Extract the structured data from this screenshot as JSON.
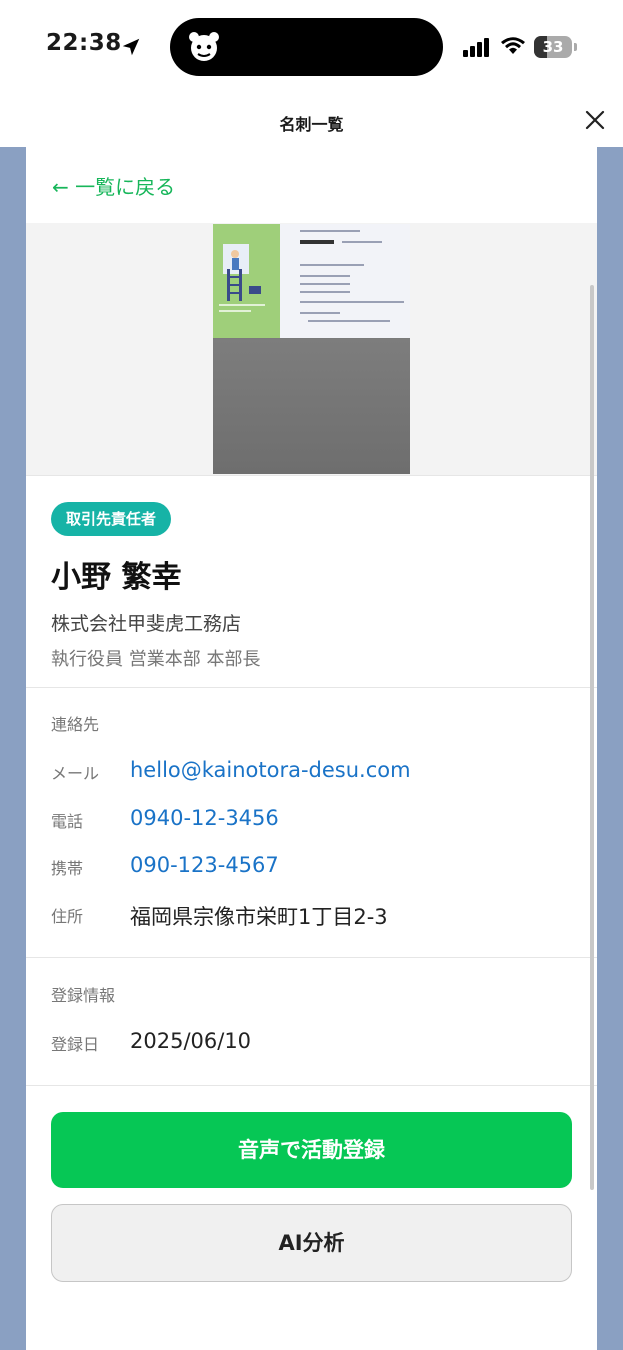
{
  "status_bar": {
    "time": "22:38",
    "battery": "33",
    "battery_level": 0.33
  },
  "header": {
    "title": "名刺一覧"
  },
  "back_link": "← 一覧に戻る",
  "card": {
    "badge": "取引先責任者",
    "name": "小野 繁幸",
    "company": "株式会社甲斐虎工務店",
    "job_title": "執行役員 営業本部 本部長"
  },
  "contact": {
    "section_title": "連絡先",
    "rows": [
      {
        "label": "メール",
        "value": "hello@kainotora-desu.com"
      },
      {
        "label": "電話",
        "value": "0940-12-3456"
      },
      {
        "label": "携帯",
        "value": "090-123-4567"
      },
      {
        "label": "住所",
        "value": "福岡県宗像市栄町1丁目2-3"
      }
    ]
  },
  "registration": {
    "section_title": "登録情報",
    "label": "登録日",
    "value": "2025/06/10"
  },
  "actions": {
    "voice_register": "音声で活動登録",
    "ai_analysis": "AI分析"
  },
  "colors": {
    "accent_green": "#06c755",
    "link_blue": "#1a73c7",
    "badge_teal": "#16b3a6",
    "backdrop": "#8aa0c2"
  },
  "icons": {
    "location": "location-arrow-icon",
    "signal": "cellular-signal-icon",
    "wifi": "wifi-icon",
    "close": "close-icon"
  }
}
